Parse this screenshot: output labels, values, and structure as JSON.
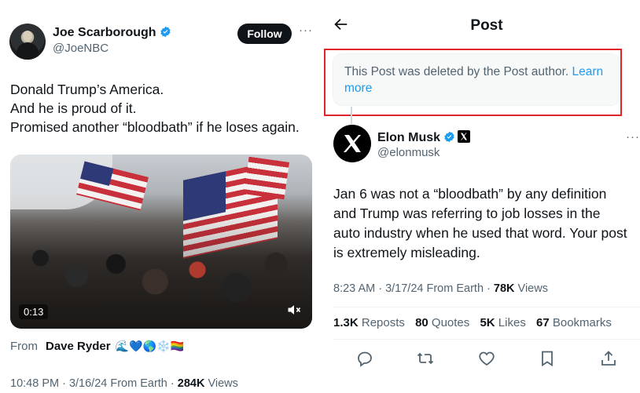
{
  "left_tweet": {
    "author_name": "Joe Scarborough",
    "handle": "@JoeNBC",
    "follow_label": "Follow",
    "text_lines": [
      "Donald Trump’s America.",
      "And he is proud of it.",
      "Promised another “bloodbath” if he loses again."
    ],
    "video_time": "0:13",
    "from_label": "From",
    "from_name": "Dave Ryder",
    "from_emoji": "🌊💙🌎❄️🏳️‍🌈",
    "meta_time": "10:48 PM · 3/16/24 From Earth · ",
    "views_count": "284K",
    "views_label": " Views"
  },
  "right_post": {
    "header_title": "Post",
    "deleted_notice": "This Post was deleted by the Post author. ",
    "learn_more": "Learn more",
    "author_name": "Elon Musk",
    "handle": "@elonmusk",
    "text_lines": [
      "Jan 6 was not a “bloodbath” by any definition",
      "and Trump was referring to job losses in the",
      "auto industry when he used that word. Your post",
      "is extremely misleading."
    ],
    "meta_time": "8:23 AM · 3/17/24 From Earth · ",
    "views_count": "78K",
    "views_label": " Views",
    "stats": {
      "reposts_count": "1.3K",
      "reposts_label": " Reposts",
      "quotes_count": "80",
      "quotes_label": " Quotes",
      "likes_count": "5K",
      "likes_label": " Likes",
      "bookmarks_count": "67",
      "bookmarks_label": " Bookmarks"
    },
    "actions": [
      "reply-icon",
      "repost-icon",
      "like-icon",
      "bookmark-icon",
      "share-icon"
    ]
  },
  "colors": {
    "accent_blue": "#1d9bf0",
    "muted_text": "#536471",
    "highlight_red": "#e0242a"
  }
}
